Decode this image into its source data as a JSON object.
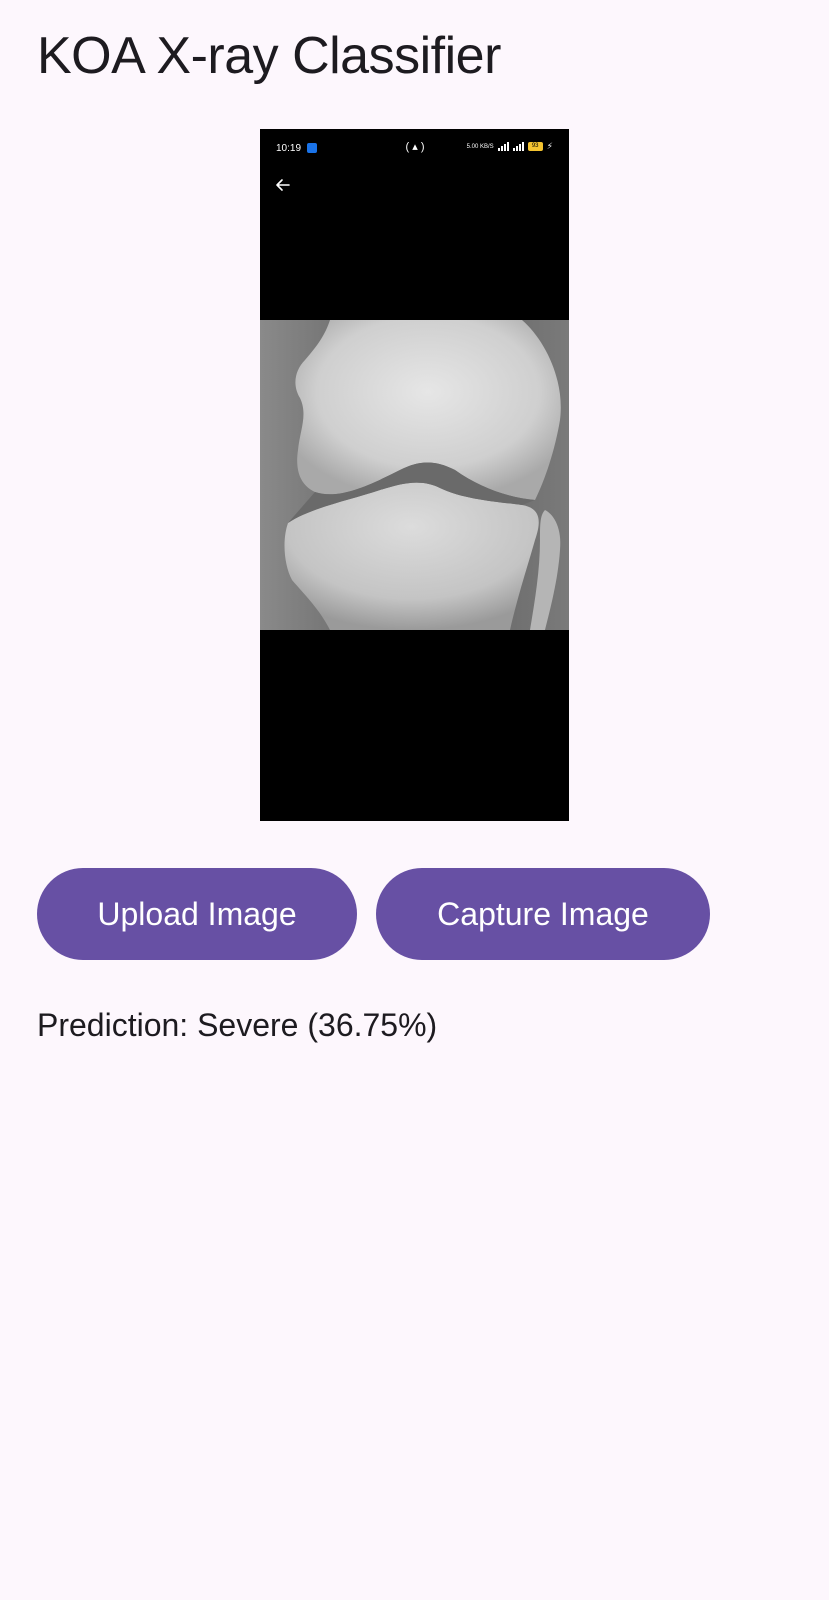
{
  "app": {
    "title": "KOA X-ray Classifier"
  },
  "preview": {
    "status_time": "10:19",
    "battery_level": "93",
    "network_text": "5.00 KB/S"
  },
  "actions": {
    "upload_label": "Upload Image",
    "capture_label": "Capture Image"
  },
  "result": {
    "prediction_text": "Prediction: Severe (36.75%)"
  },
  "colors": {
    "background": "#fdf7fd",
    "button": "#6750a4",
    "button_text": "#ffffff",
    "text": "#1d1b20"
  }
}
